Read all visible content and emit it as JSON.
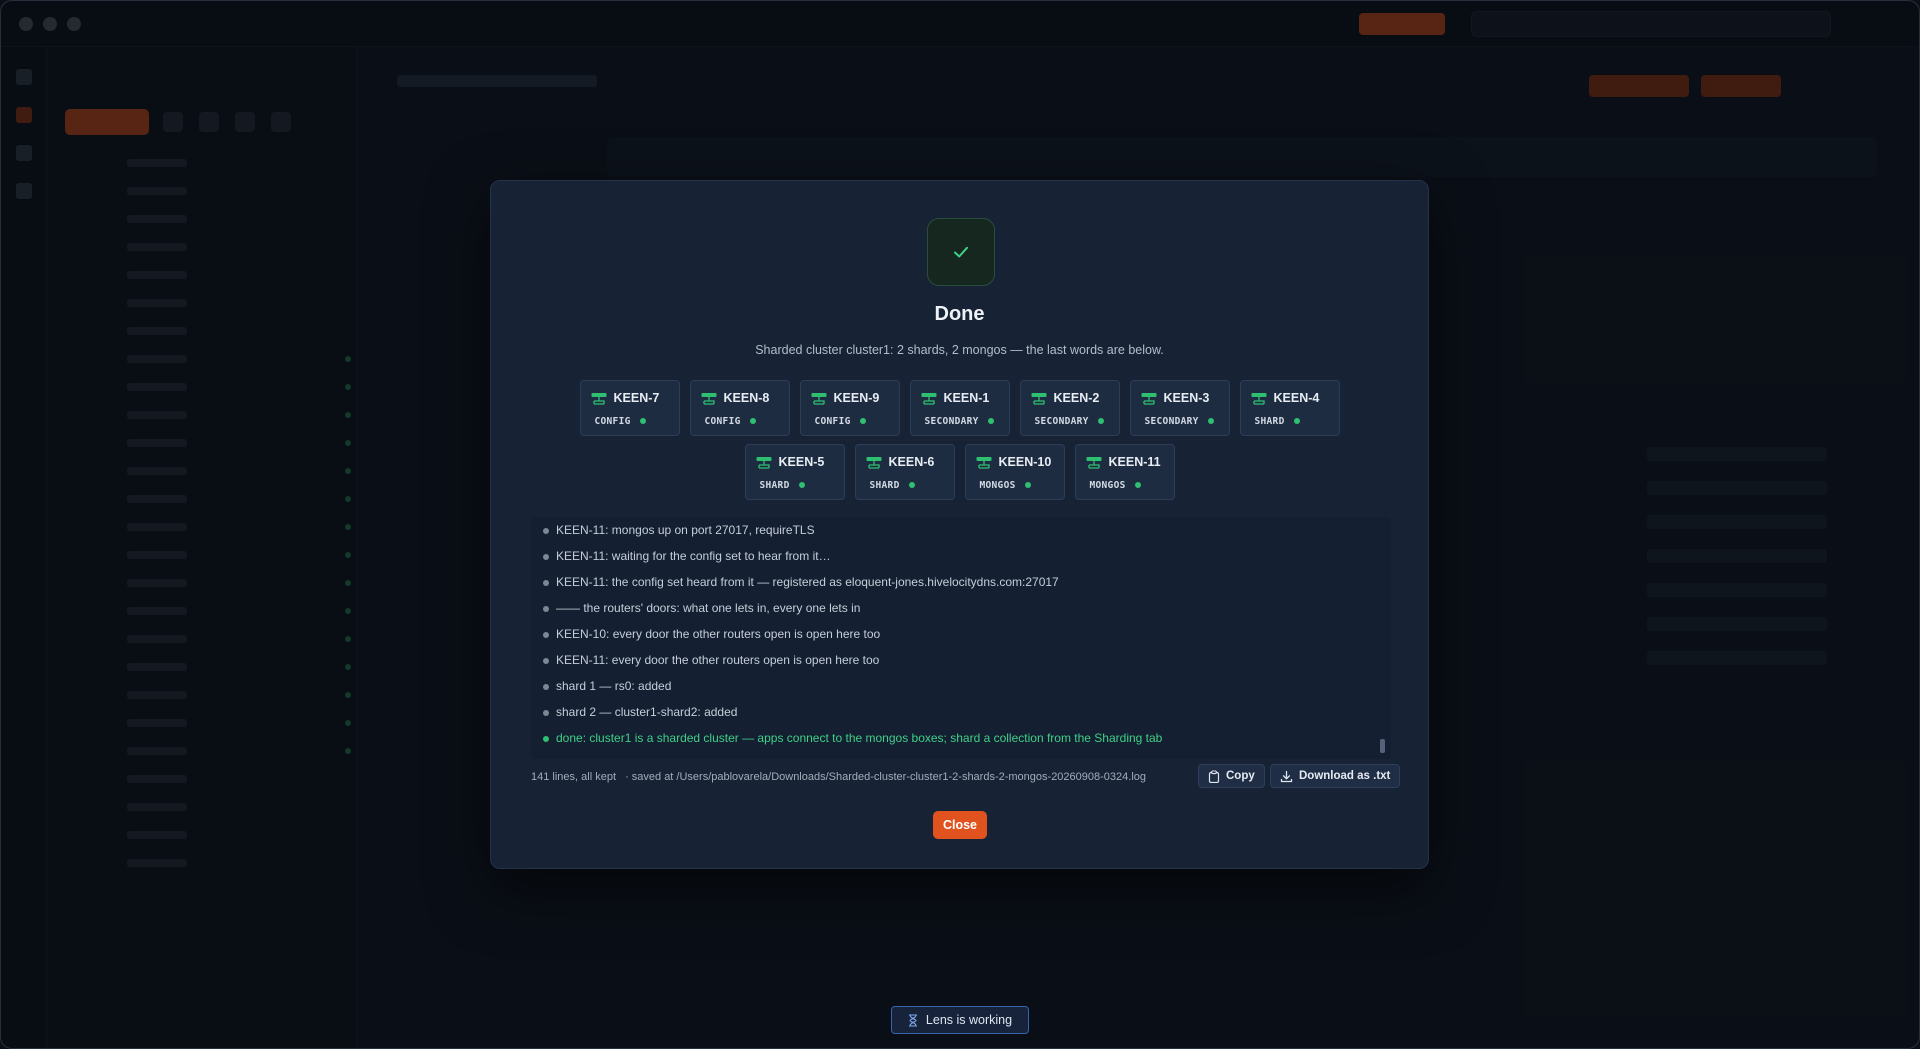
{
  "modal": {
    "title": "Done",
    "subtitle": "Sharded cluster cluster1: 2 shards, 2 mongos — the last words are below.",
    "status_icon": "checkmark-icon",
    "node_icon": "server-icon",
    "node_status_color": "#2fbf71",
    "nodes_row1": [
      {
        "name": "KEEN-7",
        "role": "CONFIG"
      },
      {
        "name": "KEEN-8",
        "role": "CONFIG"
      },
      {
        "name": "KEEN-9",
        "role": "CONFIG"
      },
      {
        "name": "KEEN-1",
        "role": "SECONDARY"
      },
      {
        "name": "KEEN-2",
        "role": "SECONDARY"
      },
      {
        "name": "KEEN-3",
        "role": "SECONDARY"
      },
      {
        "name": "KEEN-4",
        "role": "SHARD"
      }
    ],
    "nodes_row2": [
      {
        "name": "KEEN-5",
        "role": "SHARD"
      },
      {
        "name": "KEEN-6",
        "role": "SHARD"
      },
      {
        "name": "KEEN-10",
        "role": "MONGOS"
      },
      {
        "name": "KEEN-11",
        "role": "MONGOS"
      }
    ],
    "log_lines": [
      "KEEN-11: mongos up on port 27017, requireTLS",
      "KEEN-11: waiting for the config set to hear from it…",
      "KEEN-11: the config set heard from it — registered as eloquent-jones.hivelocitydns.com:27017",
      "—— the routers' doors: what one lets in, every one lets in",
      "KEEN-10: every door the other routers open is open here too",
      "KEEN-11: every door the other routers open is open here too",
      "shard 1 — rs0: added",
      "shard 2 — cluster1-shard2: added",
      "done: cluster1 is a sharded cluster — apps connect to the mongos boxes; shard a collection from the Sharding tab"
    ],
    "footer": {
      "line_count": "141 lines, all kept",
      "saved_path": "· saved at /Users/pablovarela/Downloads/Sharded-cluster-cluster1-2-shards-2-mongos-20260908-0324.log",
      "copy_label": "Copy",
      "download_label": "Download as .txt",
      "close_label": "Close"
    }
  },
  "toast": {
    "label": "Lens is working",
    "icon": "hourglass-icon"
  },
  "colors": {
    "accent": "#e0531f",
    "success": "#2fbf71",
    "toast_border": "#3a63a8"
  }
}
